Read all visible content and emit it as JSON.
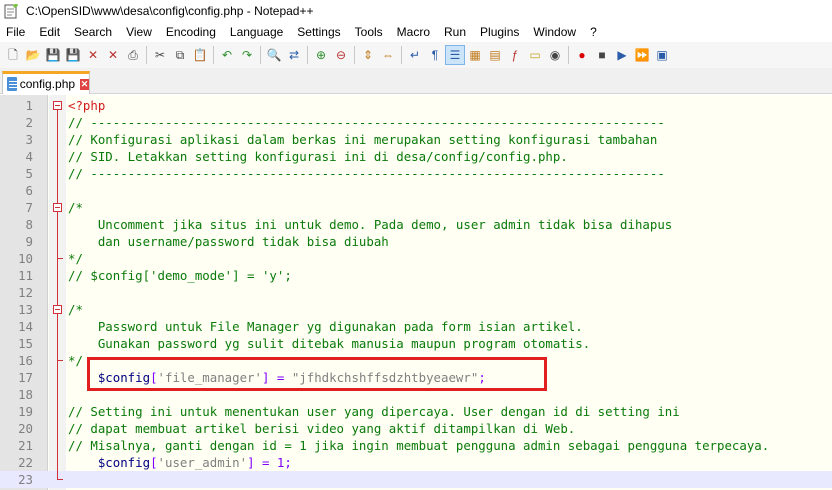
{
  "window": {
    "title": "C:\\OpenSID\\www\\desa\\config\\config.php - Notepad++"
  },
  "menu": [
    "File",
    "Edit",
    "Search",
    "View",
    "Encoding",
    "Language",
    "Settings",
    "Tools",
    "Macro",
    "Run",
    "Plugins",
    "Window",
    "?"
  ],
  "toolbar": {
    "icons": [
      "new-file-icon",
      "open-file-icon",
      "save-icon",
      "save-all-icon",
      "close-icon",
      "close-all-icon",
      "print-icon",
      "cut-icon",
      "copy-icon",
      "paste-icon",
      "undo-icon",
      "redo-icon",
      "find-icon",
      "replace-icon",
      "zoom-in-icon",
      "zoom-out-icon",
      "sync-vertical-icon",
      "sync-horizontal-icon",
      "word-wrap-icon",
      "show-all-chars-icon",
      "indent-guide-icon",
      "user-language-icon",
      "doc-map-icon",
      "function-list-icon",
      "folder-workspace-icon",
      "monitoring-icon",
      "record-macro-icon",
      "stop-record-icon",
      "play-macro-icon",
      "run-macro-multiple-icon",
      "save-macro-icon"
    ]
  },
  "tab": {
    "label": "config.php"
  },
  "editor": {
    "lines": [
      {
        "n": "1",
        "segments": [
          {
            "t": "<?php",
            "c": "tag"
          }
        ]
      },
      {
        "n": "2",
        "segments": [
          {
            "t": "// -----------------------------------------------------------------------------",
            "c": "comment"
          }
        ]
      },
      {
        "n": "3",
        "segments": [
          {
            "t": "// Konfigurasi aplikasi dalam berkas ini merupakan setting konfigurasi tambahan",
            "c": "comment"
          }
        ]
      },
      {
        "n": "4",
        "segments": [
          {
            "t": "// SID. Letakkan setting konfigurasi ini di desa/config/config.php.",
            "c": "comment"
          }
        ]
      },
      {
        "n": "5",
        "segments": [
          {
            "t": "// -----------------------------------------------------------------------------",
            "c": "comment"
          }
        ]
      },
      {
        "n": "6",
        "segments": []
      },
      {
        "n": "7",
        "segments": [
          {
            "t": "/*",
            "c": "comment"
          }
        ]
      },
      {
        "n": "8",
        "segments": [
          {
            "t": "    Uncomment jika situs ini untuk demo. Pada demo, user admin tidak bisa dihapus",
            "c": "comment"
          }
        ]
      },
      {
        "n": "9",
        "segments": [
          {
            "t": "    dan username/password tidak bisa diubah",
            "c": "comment"
          }
        ]
      },
      {
        "n": "10",
        "segments": [
          {
            "t": "*/",
            "c": "comment"
          }
        ]
      },
      {
        "n": "11",
        "segments": [
          {
            "t": "// $config['demo_mode'] = 'y';",
            "c": "comment"
          }
        ]
      },
      {
        "n": "12",
        "segments": []
      },
      {
        "n": "13",
        "segments": [
          {
            "t": "/*",
            "c": "comment"
          }
        ]
      },
      {
        "n": "14",
        "segments": [
          {
            "t": "    Password untuk File Manager yg digunakan pada form isian artikel.",
            "c": "comment"
          }
        ]
      },
      {
        "n": "15",
        "segments": [
          {
            "t": "    Gunakan password yg sulit ditebak manusia maupun program otomatis.",
            "c": "comment"
          }
        ]
      },
      {
        "n": "16",
        "segments": [
          {
            "t": "*/",
            "c": "comment"
          }
        ]
      },
      {
        "n": "17",
        "segments": [
          {
            "t": "    ",
            "c": "plain"
          },
          {
            "t": "$config",
            "c": "var"
          },
          {
            "t": "[",
            "c": "op"
          },
          {
            "t": "'file_manager'",
            "c": "str"
          },
          {
            "t": "] = ",
            "c": "op"
          },
          {
            "t": "\"jfhdkchshffsdzhtbyeaewr\"",
            "c": "str"
          },
          {
            "t": ";",
            "c": "op"
          }
        ]
      },
      {
        "n": "18",
        "segments": []
      },
      {
        "n": "19",
        "segments": [
          {
            "t": "// Setting ini untuk menentukan user yang dipercaya. User dengan id di setting ini",
            "c": "comment"
          }
        ]
      },
      {
        "n": "20",
        "segments": [
          {
            "t": "// dapat membuat artikel berisi video yang aktif ditampilkan di Web.",
            "c": "comment"
          }
        ]
      },
      {
        "n": "21",
        "segments": [
          {
            "t": "// Misalnya, ganti dengan id = 1 jika ingin membuat pengguna admin sebagai pengguna terpecaya.",
            "c": "comment"
          }
        ]
      },
      {
        "n": "22",
        "segments": [
          {
            "t": "    ",
            "c": "plain"
          },
          {
            "t": "$config",
            "c": "var"
          },
          {
            "t": "[",
            "c": "op"
          },
          {
            "t": "'user_admin'",
            "c": "str"
          },
          {
            "t": "] = ",
            "c": "op"
          },
          {
            "t": "1",
            "c": "op"
          },
          {
            "t": ";",
            "c": "op"
          }
        ]
      },
      {
        "n": "23",
        "segments": []
      }
    ]
  }
}
